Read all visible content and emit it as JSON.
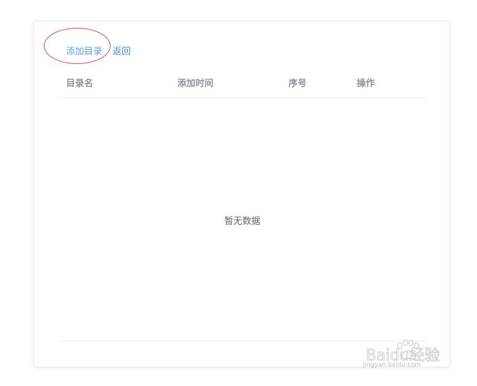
{
  "toolbar": {
    "add_directory_label": "添加目录",
    "back_label": "返回"
  },
  "table": {
    "columns": [
      "目录名",
      "添加时间",
      "序号",
      "操作"
    ],
    "rows": [],
    "empty_text": "暂无数据"
  },
  "watermark": {
    "brand": "Baidu经验",
    "url": "jingyan.baidu.com"
  },
  "colors": {
    "link": "#3a8ee6",
    "annotation": "#e24b4b",
    "header_text": "#909399",
    "border": "#ebeef5"
  },
  "icons": {
    "annotation": "red-circle-annotation",
    "watermark": "baidu-paw-logo-icon"
  }
}
